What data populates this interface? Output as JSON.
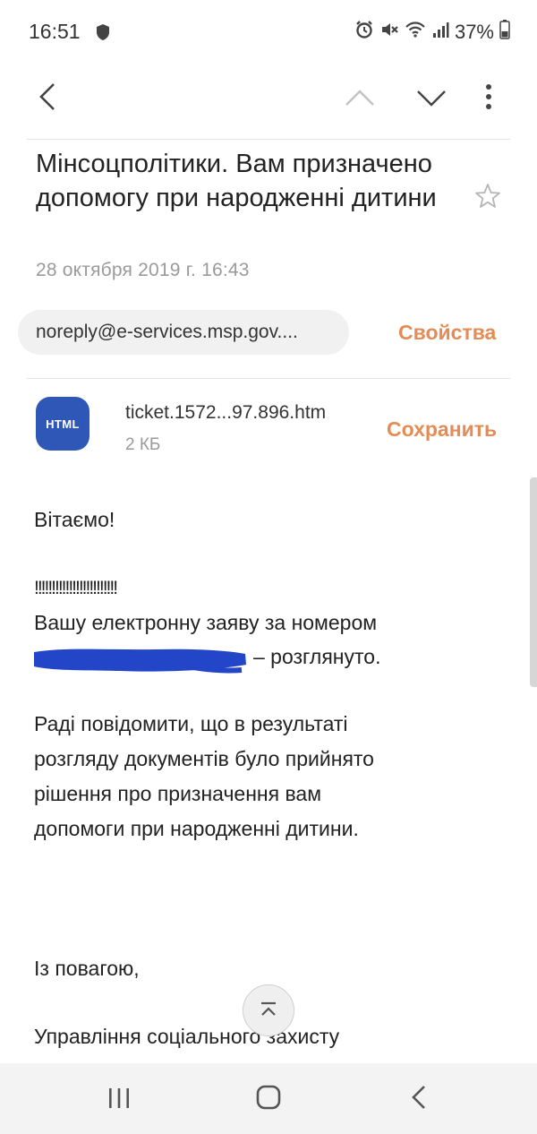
{
  "status_bar": {
    "time": "16:51",
    "battery": "37%",
    "icons": [
      "shield-icon",
      "alarm-icon",
      "mute-icon",
      "wifi-icon",
      "signal-icon",
      "battery-icon"
    ]
  },
  "toolbar": {
    "back": "back-arrow-icon",
    "prev": "chevron-up-icon",
    "next": "chevron-down-icon",
    "more": "more-vert-icon"
  },
  "email": {
    "subject": "Мінсоцполітики. Вам призначено допомогу при народженні дитини",
    "date": "28 октября 2019 г.  16:43",
    "sender": "noreply@e-services.msp.gov....",
    "properties_label": "Свойства"
  },
  "attachment": {
    "type_label": "HTML",
    "filename": "ticket.1572...97.896.htm",
    "size": "2 КБ",
    "save_label": "Сохранить"
  },
  "body": {
    "greeting": "Вітаємо!",
    "exclaim": "!!!!!!!!!!!!!!!!!!!!!!!!",
    "line1": "Вашу електронну заяву за номером",
    "line2_suffix": "– розглянуто.",
    "para2": [
      "Раді повідомити, що в результаті",
      "розгляду документів було прийнято",
      "рішення про призначення вам",
      "допомоги при народженні дитини."
    ],
    "regards": "Із повагою,",
    "signature": "Управління соціального захисту"
  },
  "colors": {
    "accent": "#e58c56",
    "attachment_icon": "#2e57b7",
    "redaction": "#2346c9"
  }
}
